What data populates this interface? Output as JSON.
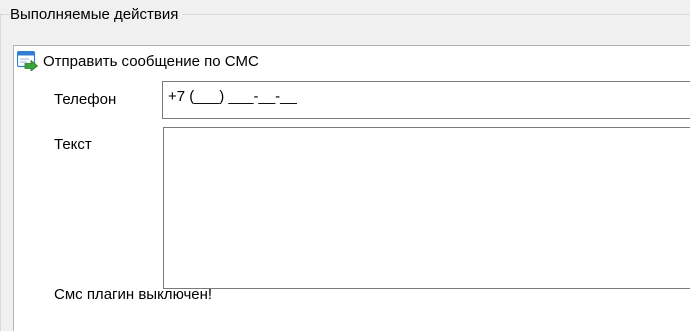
{
  "group": {
    "title": "Выполняемые действия"
  },
  "action": {
    "icon": "sms-send-icon",
    "title": "Отправить сообщение по СМС"
  },
  "phone": {
    "label": "Телефон",
    "value": "+7 (___) ___-__-__"
  },
  "text": {
    "label": "Текст",
    "value": ""
  },
  "status": {
    "message": "Смс плагин выключен!"
  },
  "colors": {
    "window_bg": "#f0f0f0",
    "panel_bg": "#ffffff",
    "input_border": "#7a7a7a",
    "icon_blue": "#2f7fd0",
    "icon_green": "#3aa33a"
  }
}
